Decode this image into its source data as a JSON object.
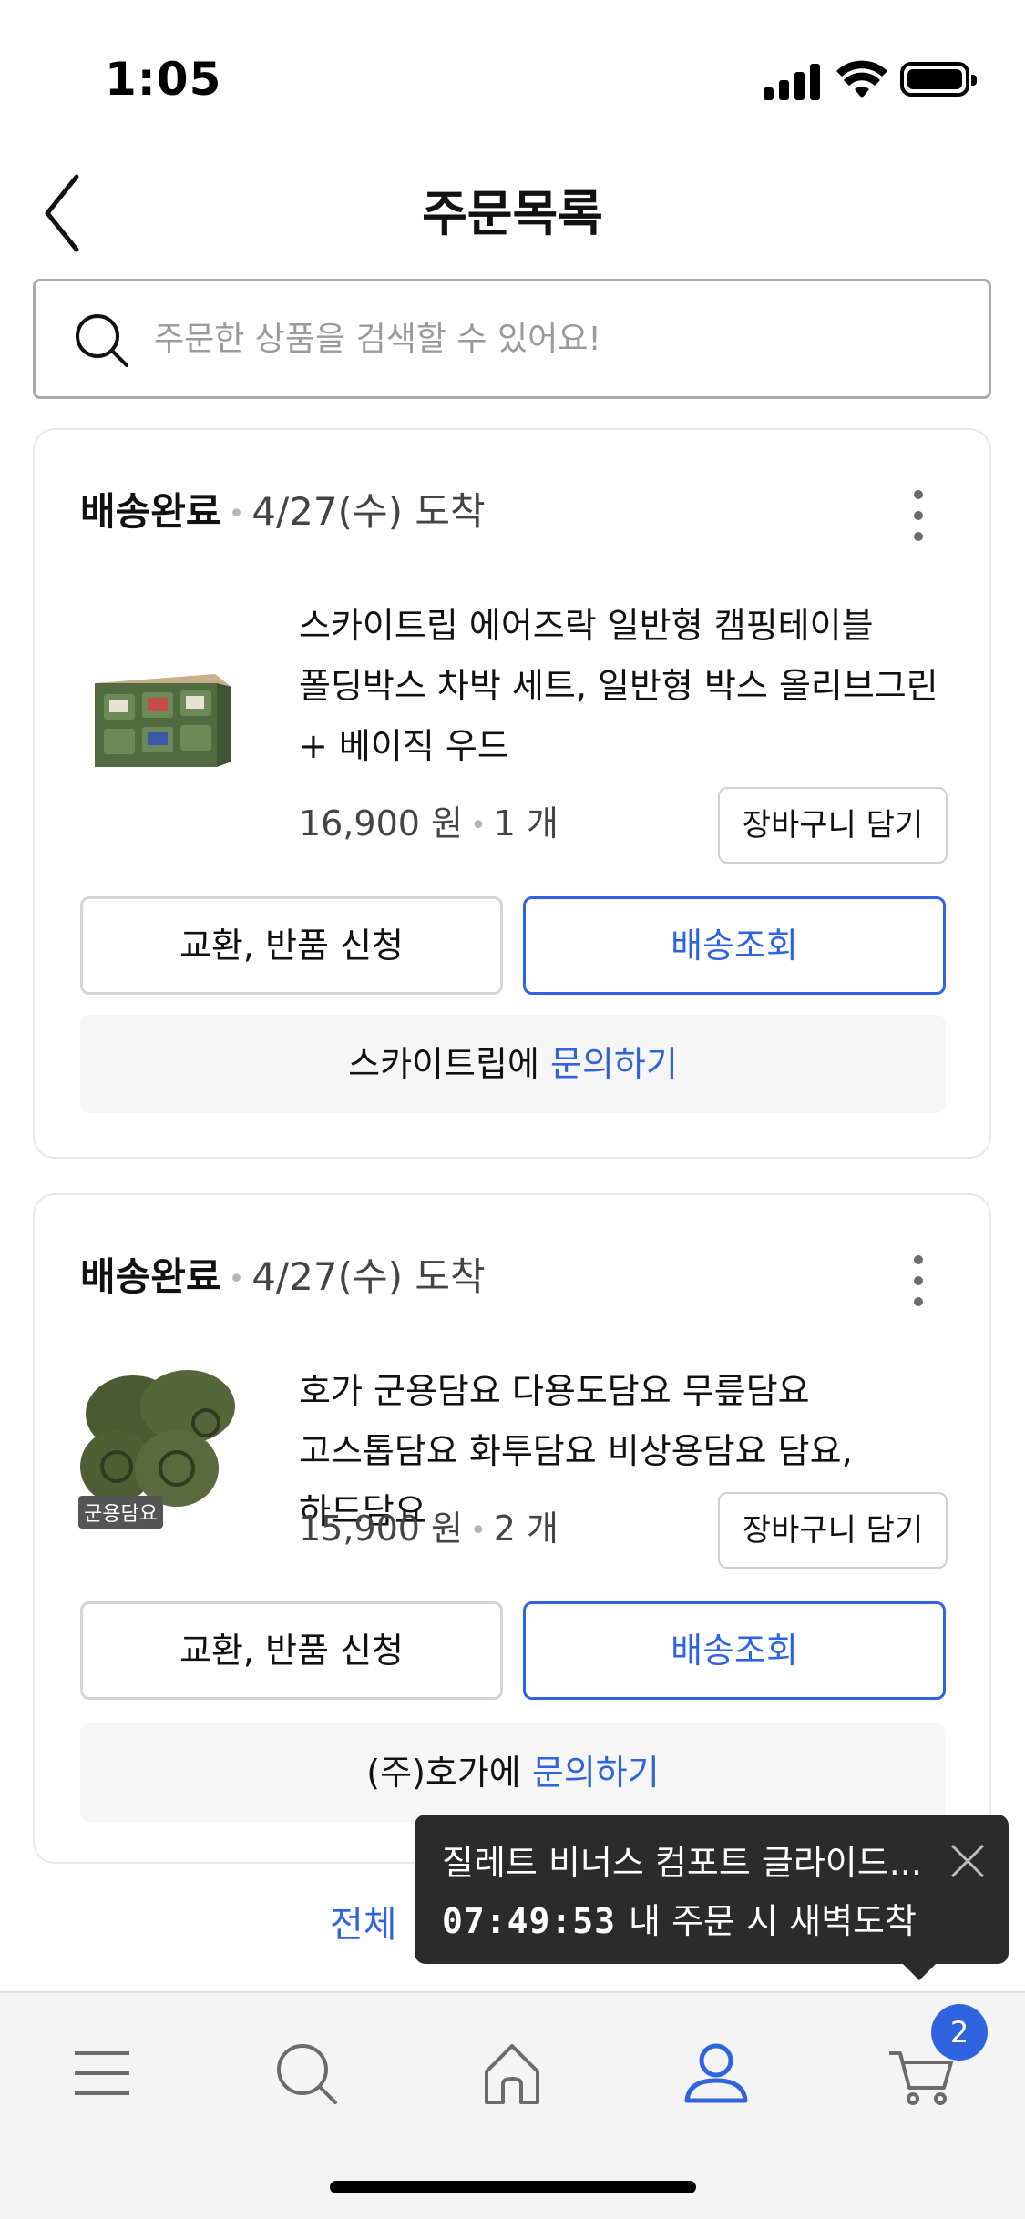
{
  "status_bar": {
    "time": "1:05"
  },
  "header": {
    "title": "주문목록"
  },
  "search": {
    "placeholder": "주문한 상품을 검색할 수 있어요!"
  },
  "orders": [
    {
      "status": "배송완료",
      "arrival": "4/27(수) 도착",
      "product_name": "스카이트립 에어즈락 일반형 캠핑테이블 폴딩박스 차박 세트, 일반형 박스 올리브그린 + 베이직 우드",
      "price": "16,900 원",
      "quantity": "1 개",
      "cart_button": "장바구니 담기",
      "exchange_button": "교환, 반품 신청",
      "track_button": "배송조회",
      "seller": "스카이트립에",
      "inquiry_link": "문의하기",
      "thumbnail_icon": "folding-box-icon"
    },
    {
      "status": "배송완료",
      "arrival": "4/27(수) 도착",
      "product_name": "호가 군용담요 다용도담요 무릎담요 고스톱담요 화투담요 비상용담요 담요, 하드담요",
      "price": "15,900 원",
      "quantity": "2 개",
      "cart_button": "장바구니 담기",
      "exchange_button": "교환, 반품 신청",
      "track_button": "배송조회",
      "seller": "(주)호가에",
      "inquiry_link": "문의하기",
      "thumbnail_label": "군용담요",
      "thumbnail_icon": "blanket-rolls-icon"
    }
  ],
  "see_all": "전체 ",
  "toast": {
    "title": "질레트 비너스 컴포트 글라이드...",
    "time": "07:49:53",
    "message": "내 주문 시 새벽도착"
  },
  "tab_bar": {
    "items": [
      "menu-icon",
      "search-icon",
      "home-icon",
      "user-icon",
      "cart-icon"
    ],
    "active": "user-icon",
    "cart_count": "2"
  },
  "colors": {
    "accent": "#2f63e0",
    "toast_bg": "#2b2b2b",
    "tab_inactive": "#6b6b6b"
  }
}
